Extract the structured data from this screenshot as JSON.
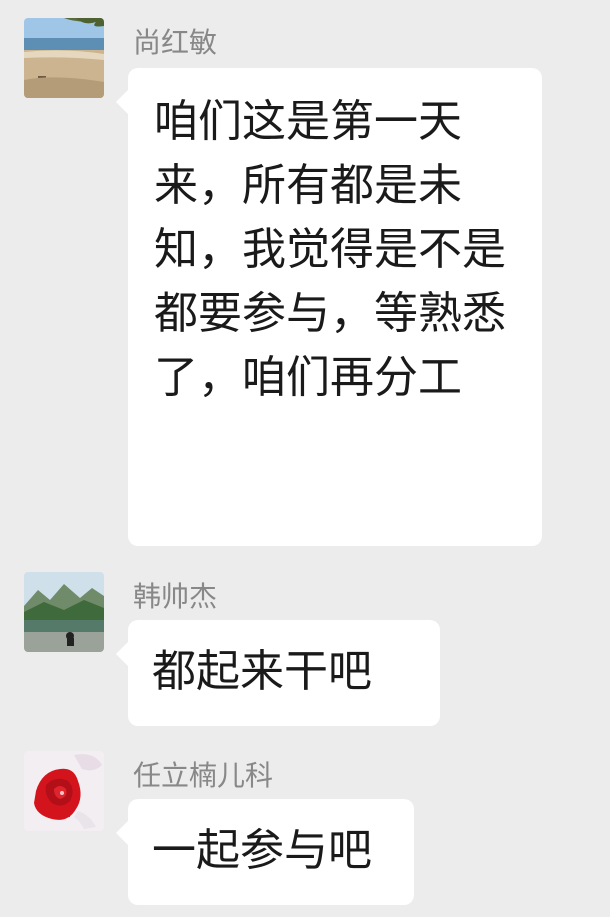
{
  "messages": [
    {
      "sender": "尚红敏",
      "text": "咱们这是第一天来，所有都是未知，我觉得是不是都要参与，等熟悉了，咱们再分工",
      "avatar_icon": "beach-photo-avatar"
    },
    {
      "sender": "韩帅杰",
      "text": "都起来干吧",
      "avatar_icon": "mountain-lake-photo-avatar"
    },
    {
      "sender": "任立楠儿科",
      "text": "一起参与吧",
      "avatar_icon": "red-rose-avatar"
    }
  ],
  "colors": {
    "background": "#ececec",
    "bubble": "#ffffff",
    "sender_name": "#888888",
    "message_text": "#1a1a1a"
  }
}
